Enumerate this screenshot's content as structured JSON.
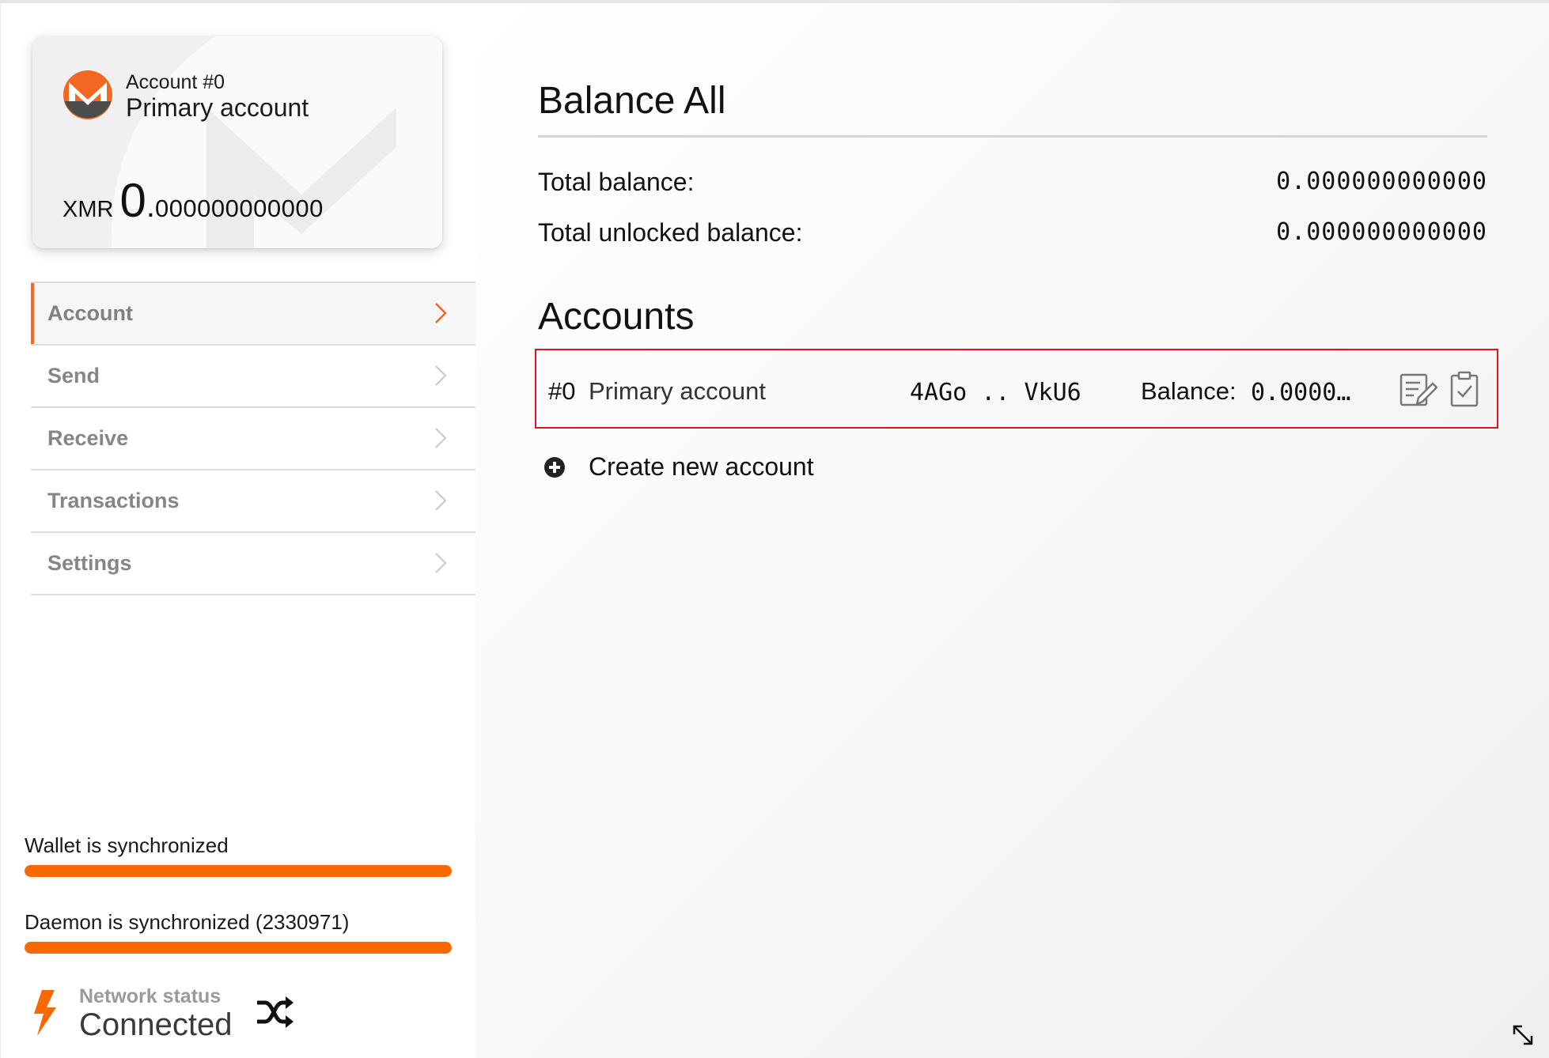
{
  "account_card": {
    "account_number": "Account #0",
    "account_name": "Primary account",
    "currency": "XMR",
    "balance_int": "0",
    "balance_dot": ".",
    "balance_dec": "000000000000",
    "logo_icon": "monero-logo",
    "accent_color": "#f26822"
  },
  "sidebar": {
    "items": [
      {
        "label": "Account",
        "active": true
      },
      {
        "label": "Send",
        "active": false
      },
      {
        "label": "Receive",
        "active": false
      },
      {
        "label": "Transactions",
        "active": false
      },
      {
        "label": "Settings",
        "active": false
      }
    ]
  },
  "sync": {
    "wallet_label": "Wallet is synchronized",
    "wallet_progress": 1.0,
    "daemon_label": "Daemon is synchronized (2330971)",
    "daemon_progress": 1.0,
    "bar_color": "#fa6800"
  },
  "network": {
    "title": "Network status",
    "value": "Connected",
    "bolt_icon": "lightning-icon",
    "switch_icon": "shuffle-icon"
  },
  "main": {
    "title": "Balance All",
    "total_balance_label": "Total balance:",
    "total_balance_value": "0.000000000000",
    "unlocked_balance_label": "Total unlocked balance:",
    "unlocked_balance_value": "0.000000000000",
    "accounts_title": "Accounts",
    "accounts": [
      {
        "index": "#0",
        "name": "Primary account",
        "address": "4AGo .. VkU6",
        "balance_label": "Balance:",
        "balance_value": "0.0000…"
      }
    ],
    "create_label": "Create new account"
  }
}
